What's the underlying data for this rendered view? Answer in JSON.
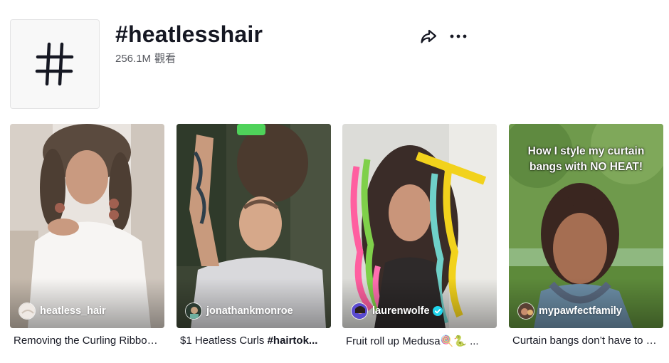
{
  "header": {
    "hashtag_icon": "hashtag-icon",
    "title": "#heatlesshair",
    "views": "256.1M",
    "views_label": "觀看",
    "share_icon": "share-icon",
    "more_icon": "more-dots-icon"
  },
  "videos": [
    {
      "author": "heatless_hair",
      "verified": false,
      "caption": "Removing the Curling Ribbon...",
      "caption_tag": "",
      "overlay_text": ""
    },
    {
      "author": "jonathankmonroe",
      "verified": false,
      "caption": "$1 Heatless Curls ",
      "caption_tag": "#hairtok...",
      "overlay_text": ""
    },
    {
      "author": "laurenwolfe",
      "verified": true,
      "caption": "Fruit roll up Medusa🍭🐍 ...",
      "caption_tag": "",
      "overlay_text": ""
    },
    {
      "author": "mypawfectfamily",
      "verified": false,
      "caption": "Curtain bangs don’t have to be...",
      "caption_tag": "",
      "overlay_text": "How I style my curtain bangs with NO HEAT!"
    }
  ],
  "colors": {
    "text": "#161823",
    "secondary_text": "#56585f",
    "verified": "#20d5ec"
  }
}
